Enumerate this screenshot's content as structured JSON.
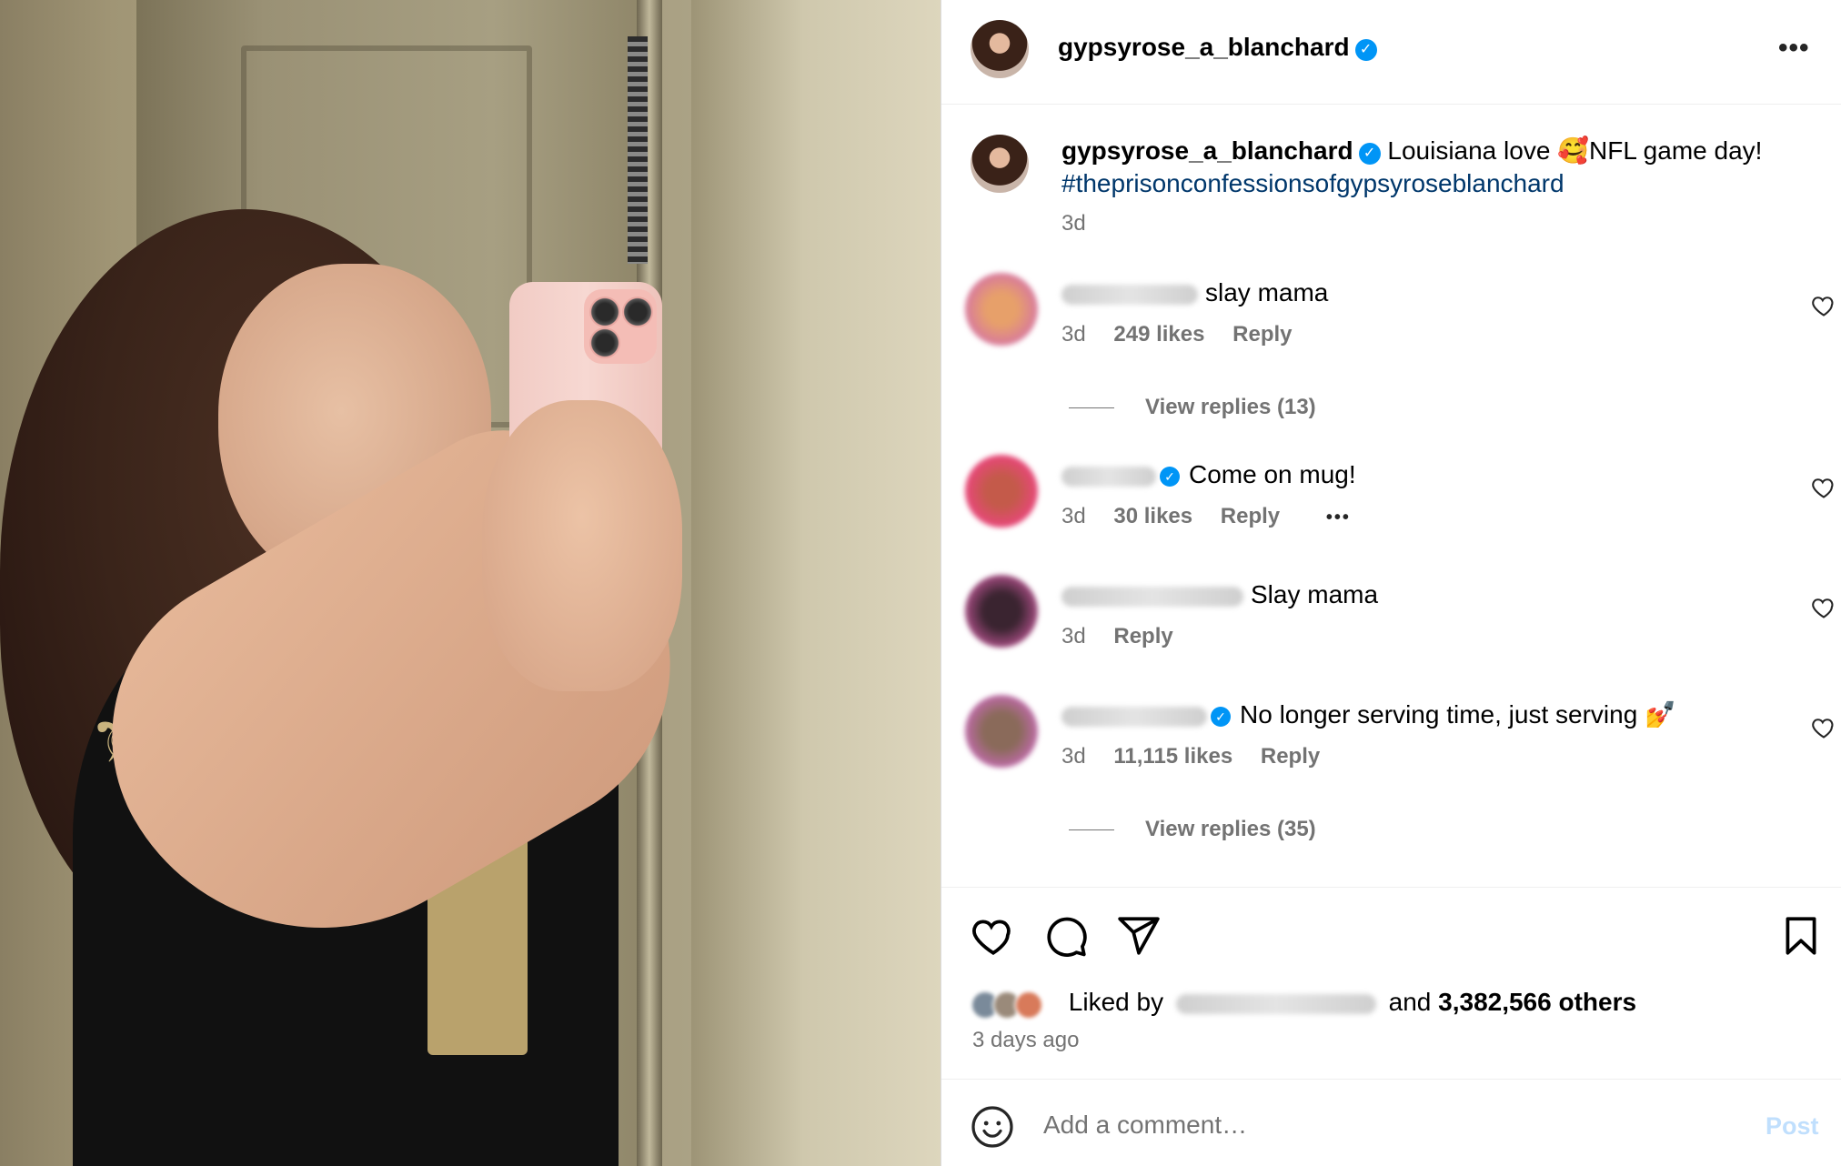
{
  "post": {
    "owner": "gypsyrose_a_blanchard",
    "caption_text": "Louisiana love 🥰NFL game day!",
    "hashtag": "#theprisonconfessionsofgypsyroseblanchard",
    "caption_time": "3d"
  },
  "comments": [
    {
      "text": "slay mama",
      "time": "3d",
      "likes": "249 likes",
      "reply": "Reply",
      "view_replies": "View replies (13)",
      "verified": false
    },
    {
      "text": "Come on mug!",
      "time": "3d",
      "likes": "30 likes",
      "reply": "Reply",
      "more": "•••",
      "verified": true
    },
    {
      "text": "Slay mama",
      "time": "3d",
      "reply": "Reply",
      "verified": false
    },
    {
      "text": "No longer serving time, just serving 💅",
      "time": "3d",
      "likes": "11,115 likes",
      "reply": "Reply",
      "view_replies": "View replies (35)",
      "verified": true
    }
  ],
  "likes": {
    "prefix": "Liked by",
    "suffix_and": "and",
    "count_text": "3,382,566 others"
  },
  "posted_ago": "3 days ago",
  "comment_box": {
    "placeholder": "Add a comment…",
    "post_label": "Post"
  },
  "more_label": "•••",
  "verified_mark": "✓",
  "colors": {
    "verified_blue": "#0095f6",
    "hashtag": "#00376b",
    "meta_gray": "#737373",
    "post_disabled": "#c0dffd"
  }
}
